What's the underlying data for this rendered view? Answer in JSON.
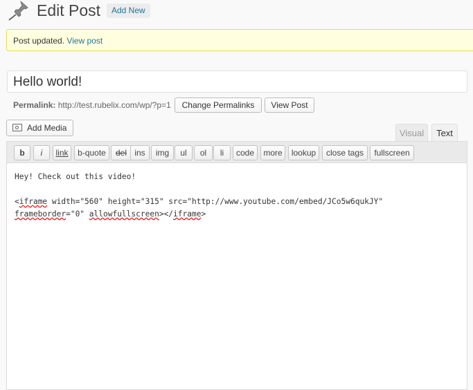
{
  "header": {
    "title": "Edit Post",
    "add_new": "Add New"
  },
  "notice": {
    "text": "Post updated.",
    "link": "View post"
  },
  "post": {
    "title": "Hello world!",
    "permalink_label": "Permalink:",
    "permalink_url": "http://test.rubelix.com/wp/?p=1",
    "change_permalinks": "Change Permalinks",
    "view_post": "View Post"
  },
  "media": {
    "add_media": "Add Media"
  },
  "tabs": {
    "visual": "Visual",
    "text": "Text"
  },
  "quicktags": [
    "b",
    "i",
    "link",
    "b-quote",
    "del",
    "ins",
    "img",
    "ul",
    "ol",
    "li",
    "code",
    "more",
    "lookup",
    "close tags",
    "fullscreen"
  ],
  "editor": {
    "line1": "Hey! Check out this video!",
    "line3a_1": "<",
    "line3a_w1": "iframe",
    "line3a_2": " width=\"560\" height=\"315\" src=\"http://www.youtube.com/embed/JCo5w6qukJY\"",
    "line3b_w1": "frameborder",
    "line3b_2": "=\"0\" ",
    "line3b_w2": "allowfullscreen",
    "line3b_3": "></",
    "line3b_w3": "iframe",
    "line3b_4": ">"
  }
}
